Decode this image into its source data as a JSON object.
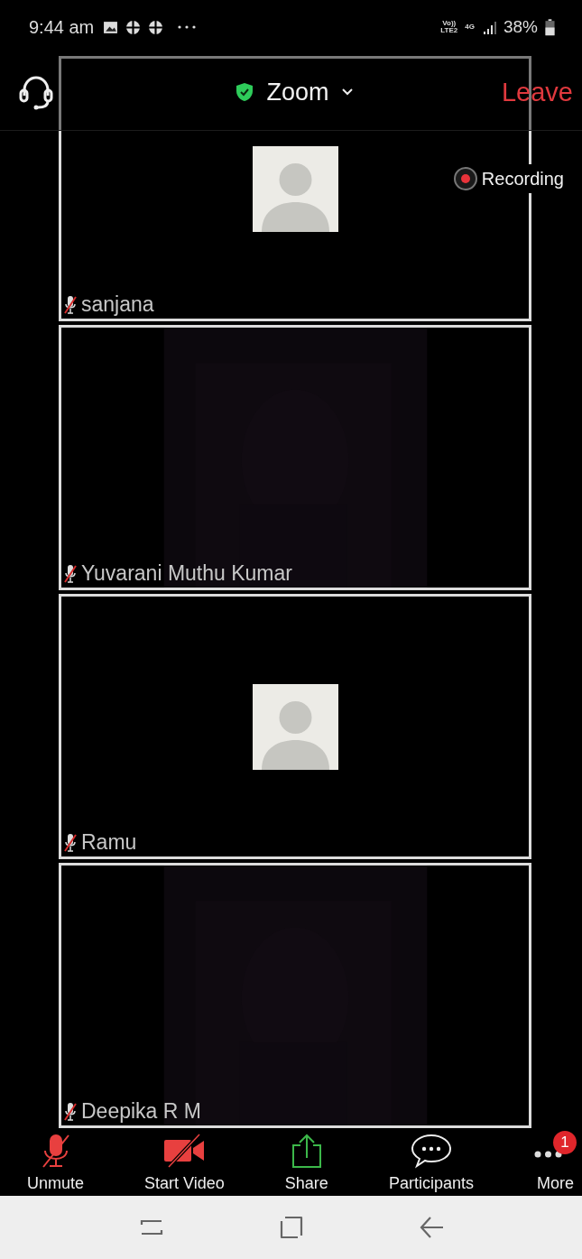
{
  "status_bar": {
    "time": "9:44 am",
    "network_top": "Vo))",
    "network_bottom": "LTE2",
    "data_type": "4G",
    "battery": "38%"
  },
  "meeting_bar": {
    "title": "Zoom",
    "secure": true,
    "leave": "Leave"
  },
  "recording": {
    "label": "Recording",
    "on": true
  },
  "tiles": [
    {
      "name": "sanjana",
      "muted": true,
      "kind": "avatar"
    },
    {
      "name": "Yuvarani Muthu Kumar",
      "muted": true,
      "kind": "video"
    },
    {
      "name": "Ramu",
      "muted": true,
      "kind": "avatar"
    },
    {
      "name": "Deepika R M",
      "muted": true,
      "kind": "video"
    }
  ],
  "toolbar": [
    {
      "label": "Unmute",
      "kind": "mic"
    },
    {
      "label": "Start Video",
      "kind": "video"
    },
    {
      "label": "Share",
      "kind": "share"
    },
    {
      "label": "Participants",
      "kind": "chat"
    },
    {
      "label": "More",
      "kind": "more",
      "badge": "1"
    }
  ]
}
